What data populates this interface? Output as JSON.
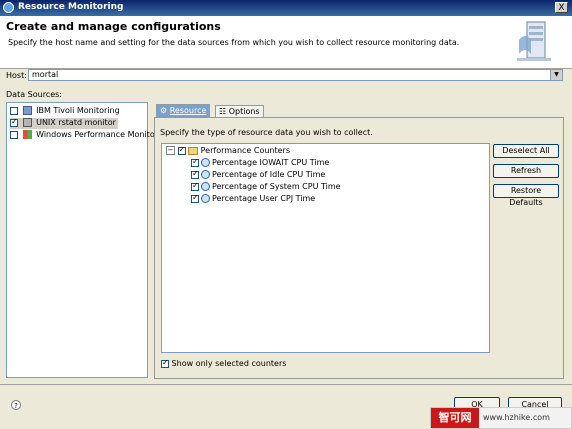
{
  "window": {
    "title": "Resource Monitoring",
    "close": "X"
  },
  "header": {
    "title": "Create and manage configurations",
    "subtitle": "Specify the host name and setting for the data sources from which you wish to collect resource monitoring data."
  },
  "host": {
    "label": "Host:",
    "value": "mortal"
  },
  "data_sources": {
    "label": "Data Sources:",
    "items": [
      {
        "label": "IBM Tivoli Monitoring",
        "checked": false
      },
      {
        "label": "UNIX rstatd monitor",
        "checked": true
      },
      {
        "label": "Windows Performance Monitor",
        "checked": false
      }
    ]
  },
  "tabs": [
    {
      "label": "Resource"
    },
    {
      "label": "Options"
    }
  ],
  "resource": {
    "instructions": "Specify the type of resource data you wish to collect.",
    "tree_root": "Performance Counters",
    "counters": [
      "Percentage IOWAIT CPU Time",
      "Percentage of Idle CPU Time",
      "Percentage of System CPU Time",
      "Percentage User CPJ Time"
    ],
    "buttons": {
      "deselect": "Deselect All",
      "refresh": "Refresh",
      "restore": "Restore Defaults"
    },
    "show_selected": "Show only selected counters"
  },
  "footer": {
    "help": "?",
    "ok": "OK",
    "cancel": "Cancel"
  },
  "watermark": {
    "brand": "智可网",
    "url": "www.hzhike.com"
  }
}
